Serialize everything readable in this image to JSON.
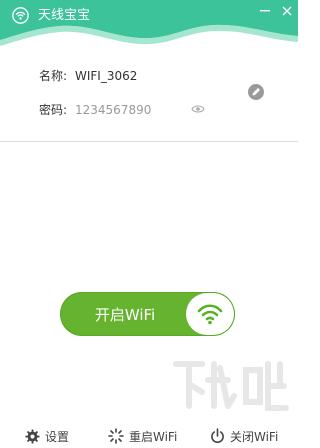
{
  "app": {
    "title": "天线宝宝"
  },
  "info": {
    "name_label": "名称:",
    "name_value": "WIFI_3062",
    "password_label": "密码:",
    "password_value": "1234567890"
  },
  "toggle": {
    "label": "开启WiFi"
  },
  "footer": {
    "settings": "设置",
    "restart": "重启WiFi",
    "close": "关闭WiFi"
  },
  "colors": {
    "header_accent": "#3cc39a",
    "toggle_green": "#65b32e",
    "wifi_icon": "#58b02a"
  },
  "icons": [
    "app-logo-icon",
    "minimize-icon",
    "close-icon",
    "eye-icon",
    "edit-icon",
    "wifi-icon",
    "gear-icon",
    "restart-icon",
    "power-icon"
  ]
}
